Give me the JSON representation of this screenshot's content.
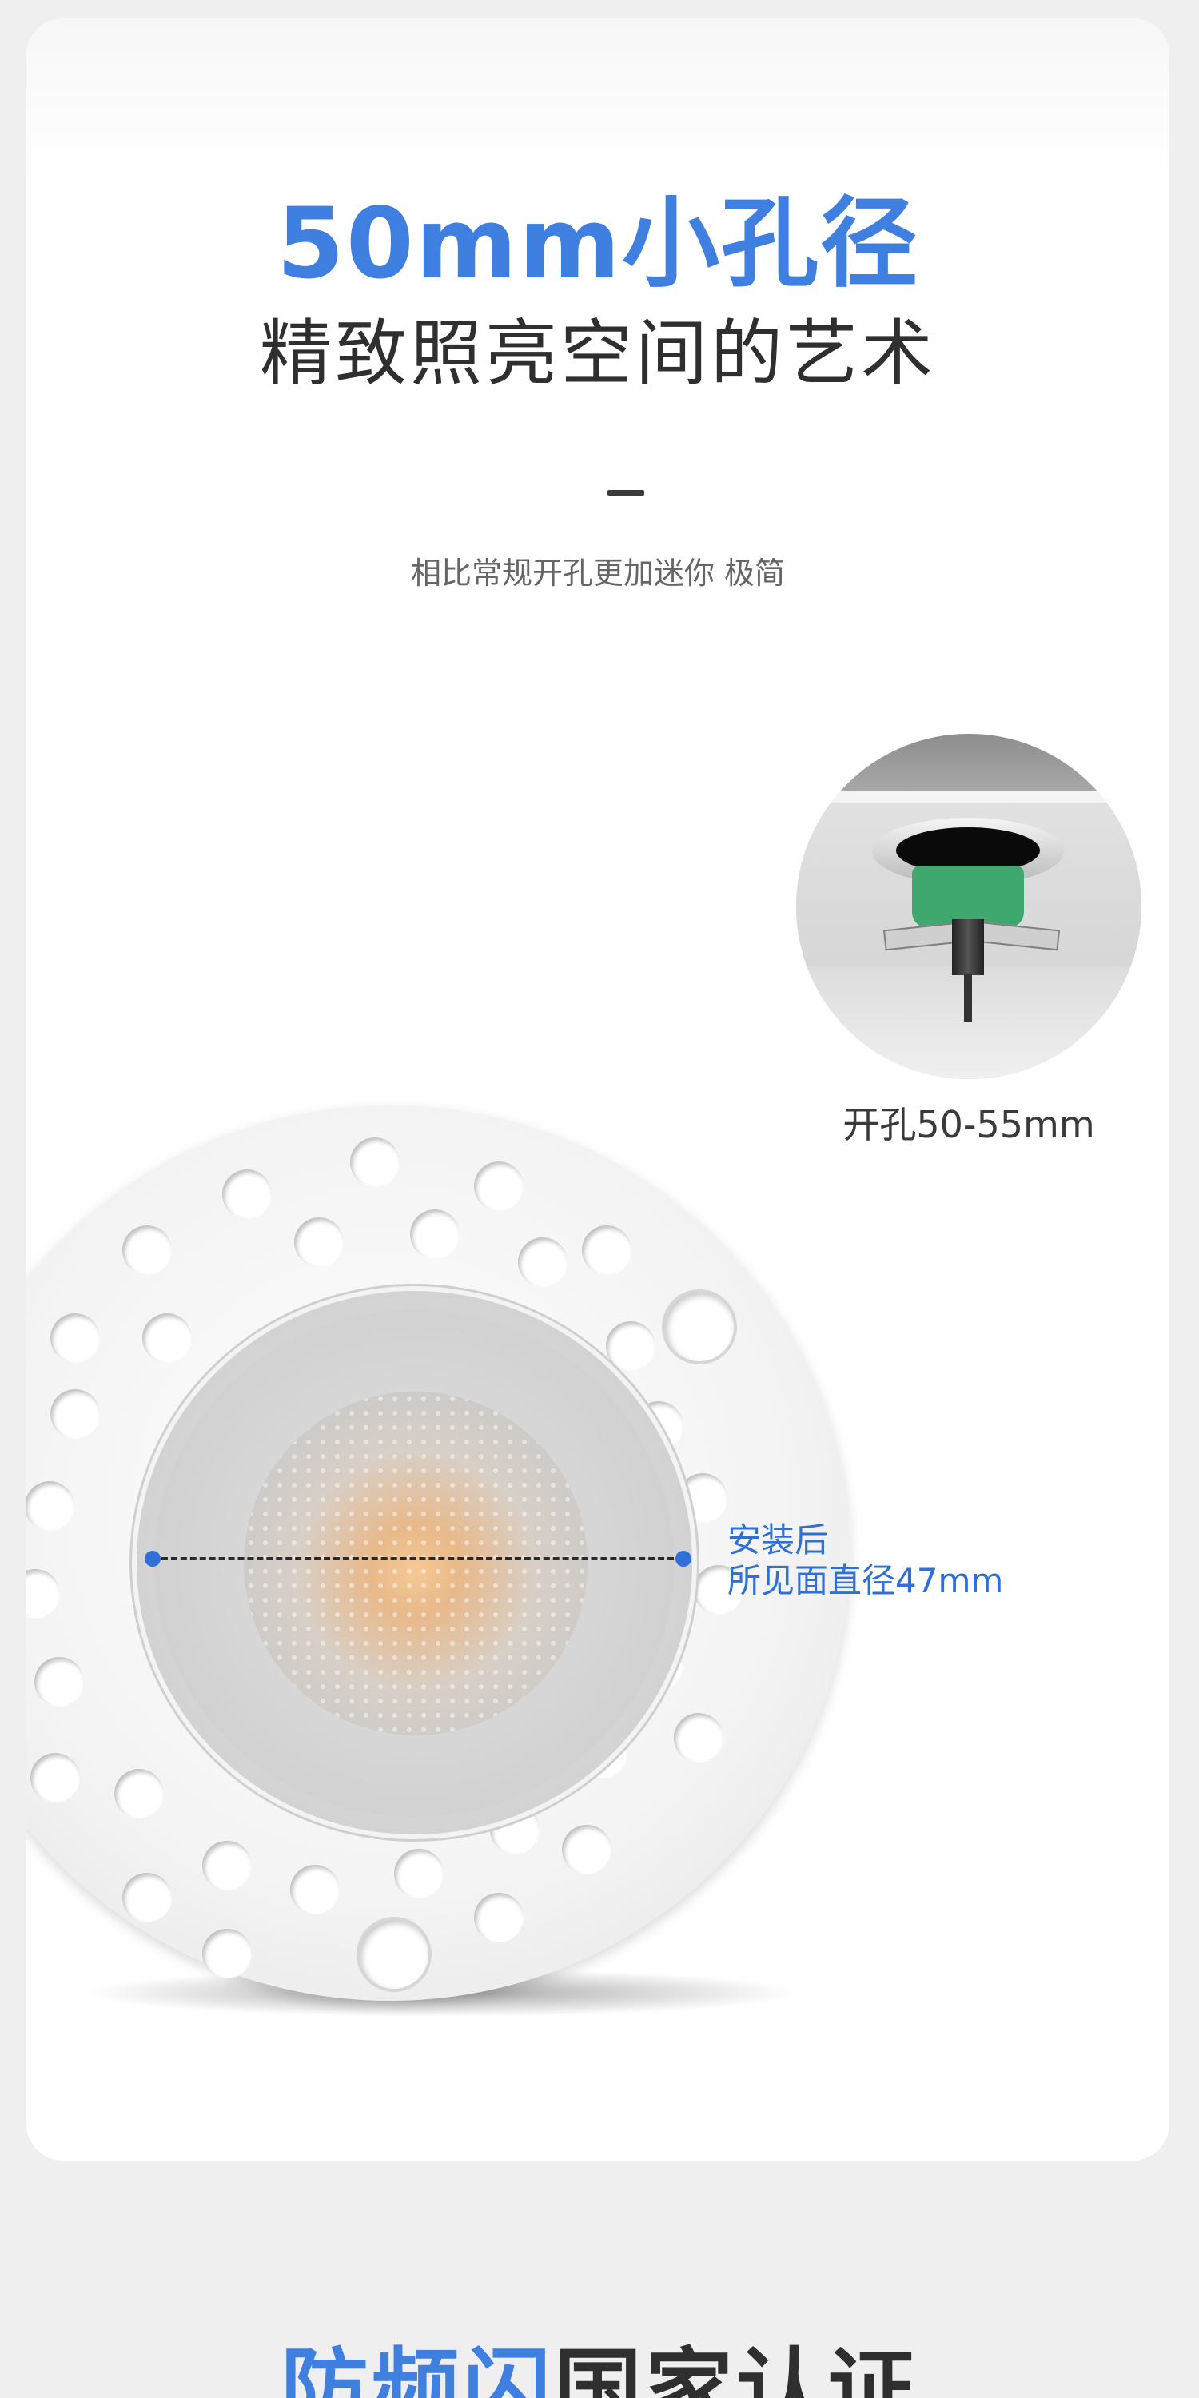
{
  "hero": {
    "title_highlight": "50mm小孔径",
    "title_main": "精致照亮空间的艺术",
    "subtitle": "相比常规开孔更加迷你 极简"
  },
  "install": {
    "cutout_label": "开孔50-55mm"
  },
  "dimension": {
    "line1": "安装后",
    "line2": "所见面直径47mm"
  },
  "next_section": {
    "title_highlight": "防频闪",
    "title_main": "国家认证"
  },
  "colors": {
    "accent": "#3f7fe0",
    "dimension": "#2f6fd6",
    "text_dark": "#2f2f2f",
    "install_clip": "#3fa86f"
  }
}
